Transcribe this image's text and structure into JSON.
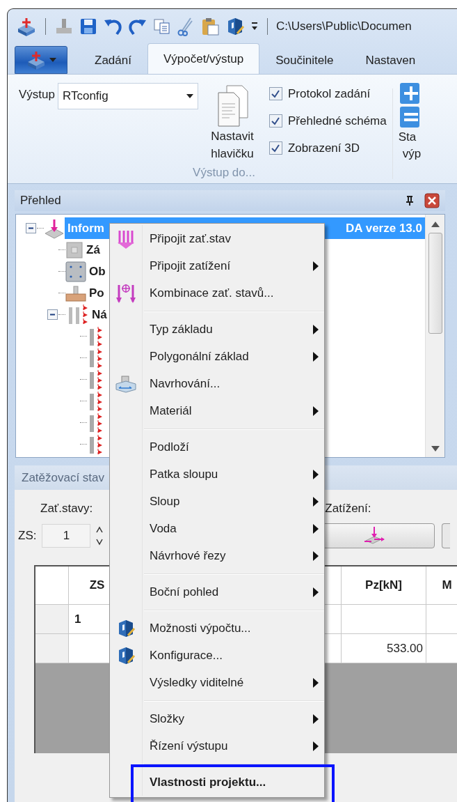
{
  "window": {
    "path": "C:\\Users\\Public\\Documen"
  },
  "ribbon": {
    "tabs": [
      {
        "label": "Zadání",
        "selected": false
      },
      {
        "label": "Výpočet/výstup",
        "selected": true
      },
      {
        "label": "Součinitele",
        "selected": false
      },
      {
        "label": "Nastaven",
        "selected": false
      }
    ],
    "output_label": "Výstup",
    "output_value": "RTconfig",
    "header_button": "Nastavit hlavičku",
    "checkboxes": [
      {
        "label": "Protokol zadání",
        "checked": true
      },
      {
        "label": "Přehledné schéma",
        "checked": true
      },
      {
        "label": "Zobrazení 3D",
        "checked": true
      }
    ],
    "group_label": "Výstup do...",
    "cut_button": [
      "Sta",
      "výp"
    ]
  },
  "overview": {
    "title": "Přehled",
    "tree": [
      {
        "kind": "project",
        "label": "Inform",
        "label_end": "DA verze 13.0",
        "selected": true,
        "expanded": true,
        "children": [
          {
            "kind": "base",
            "label": "Zá",
            "selected": false
          },
          {
            "kind": "outline",
            "label": "Ob",
            "selected": false
          },
          {
            "kind": "footing",
            "label": "Po",
            "selected": false
          },
          {
            "kind": "loads",
            "label": "Ná",
            "selected": false,
            "expanded": true,
            "children": [
              {
                "kind": "load",
                "selected": false
              },
              {
                "kind": "load",
                "selected": false
              },
              {
                "kind": "load",
                "selected": false
              },
              {
                "kind": "load",
                "selected": false
              },
              {
                "kind": "load",
                "selected": false
              },
              {
                "kind": "load",
                "selected": false
              }
            ]
          }
        ]
      }
    ]
  },
  "loads_panel": {
    "title": "Zatěžovací stav",
    "cases_label": "Zať.stavy:",
    "loads_label": "Zatížení:",
    "zs_label": "ZS:",
    "zs_value": "1",
    "table": {
      "columns": [
        "ZS",
        "Pz[kN]",
        "M"
      ],
      "rows": [
        [
          "1",
          null,
          null
        ],
        [
          null,
          "533.00",
          null
        ]
      ]
    }
  },
  "context_menu": {
    "items": [
      {
        "kind": "load-case",
        "label": "Připojit zať.stav",
        "submenu": false,
        "default": false,
        "highlighted": false
      },
      {
        "kind": "plain",
        "label": "Připojit zatížení",
        "submenu": true,
        "default": false,
        "highlighted": false
      },
      {
        "kind": "combination",
        "label": "Kombinace zať. stavů...",
        "submenu": false,
        "default": false,
        "highlighted": false
      },
      {
        "kind": "separator"
      },
      {
        "kind": "plain",
        "label": "Typ základu",
        "submenu": true,
        "default": false,
        "highlighted": false
      },
      {
        "kind": "plain",
        "label": "Polygonální základ",
        "submenu": true,
        "default": false,
        "highlighted": false
      },
      {
        "kind": "design",
        "label": "Navrhování...",
        "submenu": false,
        "default": false,
        "highlighted": false
      },
      {
        "kind": "plain",
        "label": "Materiál",
        "submenu": true,
        "default": false,
        "highlighted": false
      },
      {
        "kind": "separator"
      },
      {
        "kind": "plain",
        "label": "Podloží",
        "submenu": false,
        "default": false,
        "highlighted": false
      },
      {
        "kind": "plain",
        "label": "Patka sloupu",
        "submenu": true,
        "default": false,
        "highlighted": false
      },
      {
        "kind": "plain",
        "label": "Sloup",
        "submenu": true,
        "default": false,
        "highlighted": false
      },
      {
        "kind": "plain",
        "label": "Voda",
        "submenu": true,
        "default": false,
        "highlighted": false
      },
      {
        "kind": "plain",
        "label": "Návrhové řezy",
        "submenu": true,
        "default": false,
        "highlighted": false
      },
      {
        "kind": "separator"
      },
      {
        "kind": "plain",
        "label": "Boční pohled",
        "submenu": true,
        "default": false,
        "highlighted": false
      },
      {
        "kind": "separator"
      },
      {
        "kind": "settings",
        "label": "Možnosti výpočtu...",
        "submenu": false,
        "default": false,
        "highlighted": false
      },
      {
        "kind": "settings",
        "label": "Konfigurace...",
        "submenu": false,
        "default": false,
        "highlighted": false
      },
      {
        "kind": "plain",
        "label": "Výsledky viditelné",
        "submenu": true,
        "default": false,
        "highlighted": false
      },
      {
        "kind": "separator"
      },
      {
        "kind": "plain",
        "label": "Složky",
        "submenu": true,
        "default": false,
        "highlighted": false
      },
      {
        "kind": "plain",
        "label": "Řízení výstupu",
        "submenu": true,
        "default": false,
        "highlighted": false
      },
      {
        "kind": "separator"
      },
      {
        "kind": "plain",
        "label": "Vlastnosti projektu...",
        "submenu": false,
        "default": true,
        "highlighted": true
      }
    ]
  }
}
